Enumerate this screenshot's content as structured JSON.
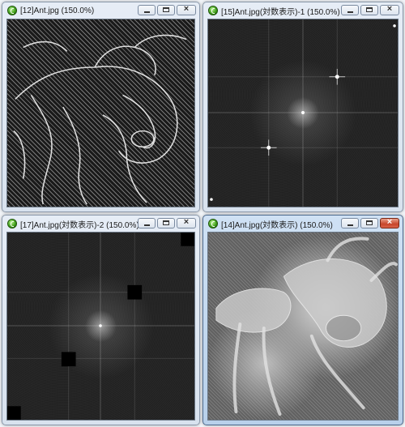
{
  "windows": [
    {
      "title": "[12]Ant.jpg (150.0%)",
      "active": false,
      "icon": "app-icon"
    },
    {
      "title": "[15]Ant.jpg(対数表示)-1 (150.0%)",
      "active": false,
      "icon": "app-icon"
    },
    {
      "title": "[17]Ant.jpg(対数表示)-2 (150.0%)",
      "active": false,
      "icon": "app-icon"
    },
    {
      "title": "[14]Ant.jpg(対数表示) (150.0%)",
      "active": true,
      "icon": "app-icon"
    }
  ],
  "controls": {
    "minimize": "minimize-button",
    "maximize": "maximize-button",
    "close": "close-button"
  },
  "colors": {
    "titlebar_inactive": "#dce5f0",
    "titlebar_active": "#bcd2ea",
    "close_active": "#c7452a"
  }
}
